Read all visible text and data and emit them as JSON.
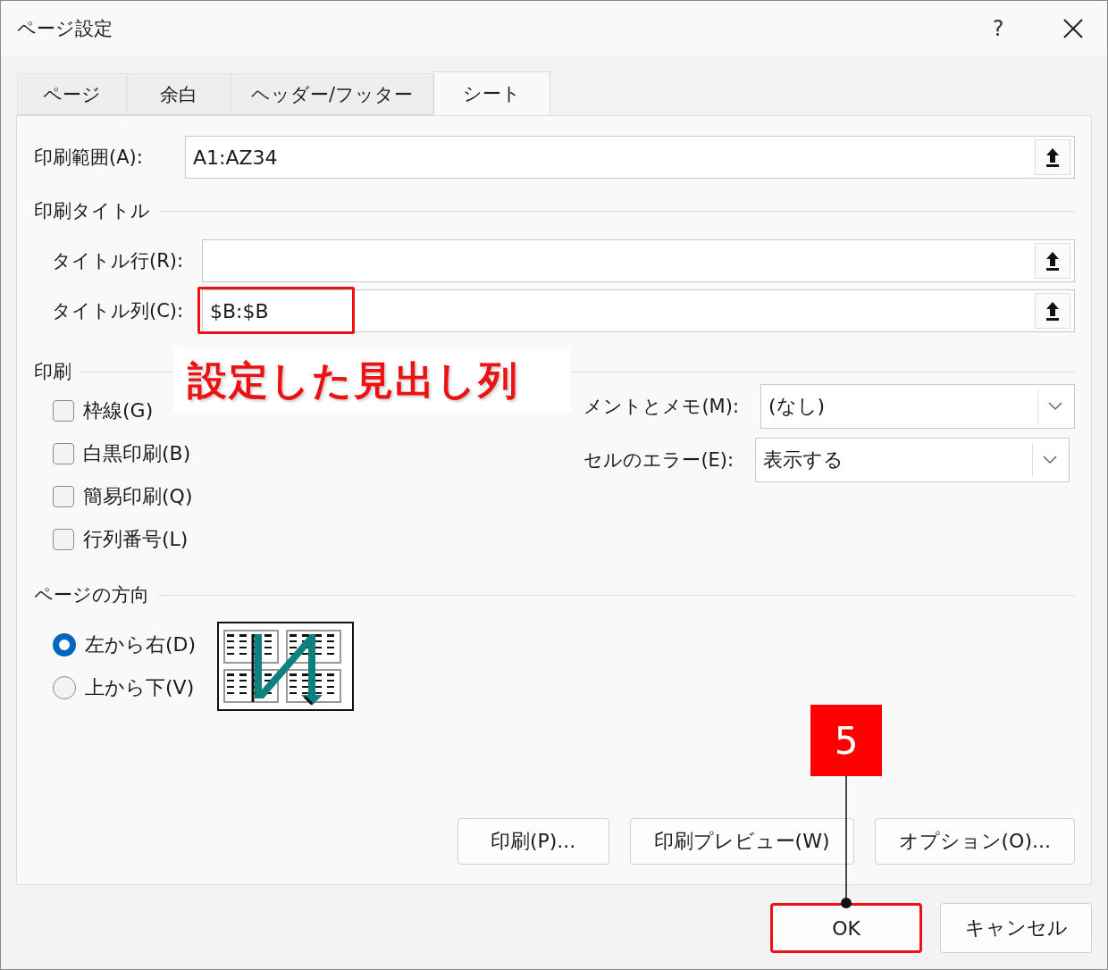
{
  "window": {
    "title": "ページ設定",
    "help": "?"
  },
  "tabs": [
    {
      "label": "ページ",
      "selected": false
    },
    {
      "label": "余白",
      "selected": false
    },
    {
      "label": "ヘッダー/フッター",
      "selected": false
    },
    {
      "label": "シート",
      "selected": true
    }
  ],
  "print_area": {
    "label": "印刷範囲(A):",
    "value": "A1:AZ34"
  },
  "print_titles": {
    "heading": "印刷タイトル",
    "rows": [
      {
        "label": "タイトル行(R):",
        "highlighted": false
      },
      {
        "label": "タイトル列(C):",
        "value": "$B:$B",
        "highlighted": true
      }
    ]
  },
  "print": {
    "heading": "印刷",
    "options": [
      {
        "label": "枠線(G)",
        "checked": false
      },
      {
        "label": "白黒印刷(B)",
        "checked": false
      },
      {
        "label": "簡易印刷(Q)",
        "checked": false
      },
      {
        "label": "行列番号(L)",
        "checked": false
      }
    ],
    "dropdowns": [
      {
        "label": "メントとメモ(M):",
        "value": "(なし)"
      },
      {
        "label": "セルのエラー(E):",
        "value": "表示する"
      }
    ]
  },
  "page_order": {
    "heading": "ページの方向",
    "options": [
      {
        "label": "左から右(D)",
        "selected": true
      },
      {
        "label": "上から下(V)",
        "selected": false
      }
    ]
  },
  "buttons": [
    "印刷(P)...",
    "印刷プレビュー(W)",
    "オプション(O)..."
  ],
  "footer_buttons": [
    {
      "label": "OK",
      "highlighted": true
    },
    {
      "label": "キャンセル",
      "highlighted": false
    }
  ],
  "callout": "設定した見出し列",
  "step": "5"
}
